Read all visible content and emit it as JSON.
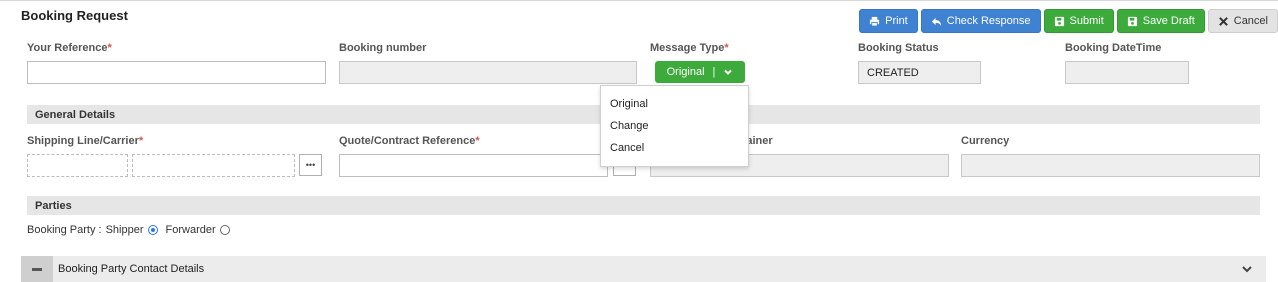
{
  "header": {
    "title": "Booking Request",
    "buttons": {
      "print": "Print",
      "check_response": "Check Response",
      "submit": "Submit",
      "save_draft": "Save Draft",
      "cancel": "Cancel"
    }
  },
  "fields": {
    "your_reference": {
      "label": "Your Reference",
      "required": "*",
      "value": ""
    },
    "booking_number": {
      "label": "Booking number",
      "value": ""
    },
    "message_type": {
      "label": "Message Type",
      "required": "*",
      "selected": "Original",
      "separator": "|",
      "options": [
        "Original",
        "Change",
        "Cancel"
      ]
    },
    "booking_status": {
      "label": "Booking Status",
      "value": "CREATED"
    },
    "booking_datetime": {
      "label": "Booking DateTime",
      "value": ""
    }
  },
  "general_details": {
    "title": "General Details",
    "shipping_line": {
      "label": "Shipping Line/Carrier",
      "required": "*"
    },
    "quote_reference": {
      "label": "Quote/Contract Reference",
      "required": "*"
    },
    "container": {
      "label_visible": "ntainer"
    },
    "currency": {
      "label": "Currency"
    }
  },
  "parties": {
    "title": "Parties",
    "booking_party_label": "Booking Party :",
    "options": [
      "Shipper",
      "Forwarder"
    ],
    "selected": "Shipper"
  },
  "contact_section": {
    "title": "Booking Party Contact Details"
  },
  "colors": {
    "blue_button": "#3f82d2",
    "green_button": "#3cab3c",
    "required": "#d9534f"
  }
}
